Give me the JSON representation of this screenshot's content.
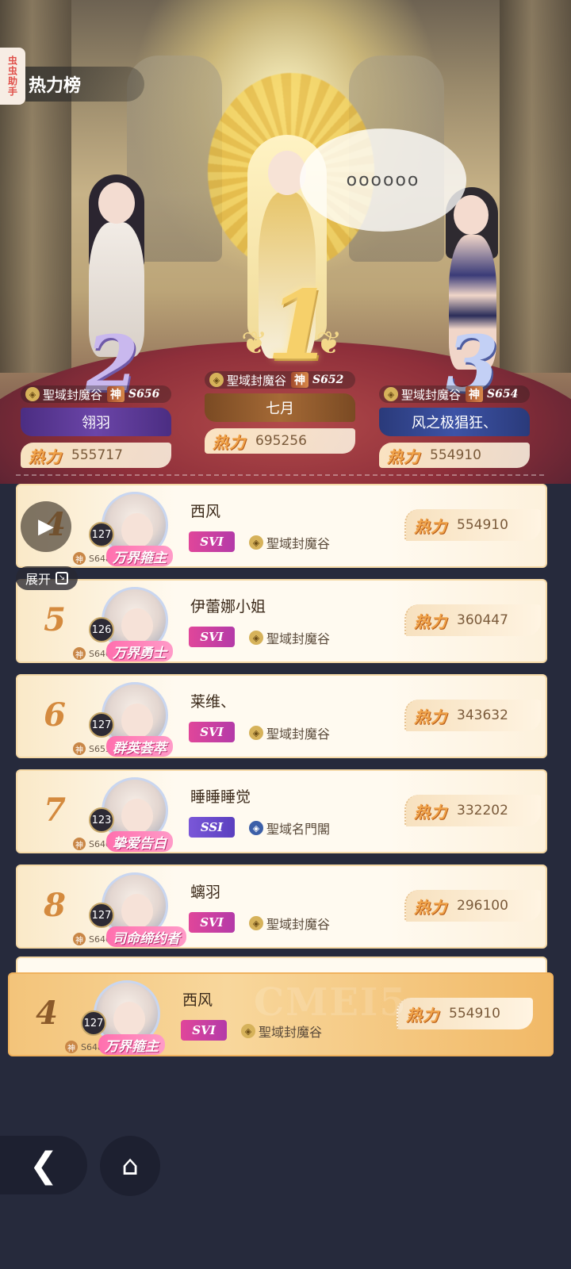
{
  "side_tab": {
    "label": "虫虫助手"
  },
  "header": {
    "title": "热力榜"
  },
  "speech_bubble": {
    "text": "oooooo"
  },
  "podium": [
    {
      "rank": "1",
      "guild": "聖域封魔谷",
      "shen": "神",
      "server": "S652",
      "name": "七月",
      "heat_label": "热力",
      "heat": "695256"
    },
    {
      "rank": "2",
      "guild": "聖域封魔谷",
      "shen": "神",
      "server": "S656",
      "name": "翎羽",
      "heat_label": "热力",
      "heat": "555717"
    },
    {
      "rank": "3",
      "guild": "聖域封魔谷",
      "shen": "神",
      "server": "S654",
      "name": "风之极猖狂、",
      "heat_label": "热力",
      "heat": "554910"
    }
  ],
  "list": [
    {
      "rank": "4",
      "level": "127",
      "shen": "神",
      "server": "S648",
      "title": "万界箍主",
      "name": "西风",
      "vip": "SVI",
      "guild": "聖域封魔谷",
      "heat_label": "热力",
      "heat": "554910"
    },
    {
      "rank": "5",
      "level": "126",
      "shen": "神",
      "server": "S646",
      "title": "万界勇士",
      "name": "伊蕾娜小姐",
      "vip": "SVI",
      "guild": "聖域封魔谷",
      "heat_label": "热力",
      "heat": "360447"
    },
    {
      "rank": "6",
      "level": "127",
      "shen": "神",
      "server": "S653",
      "title": "群英荟萃",
      "name": "莱维、",
      "vip": "SVI",
      "guild": "聖域封魔谷",
      "heat_label": "热力",
      "heat": "343632"
    },
    {
      "rank": "7",
      "level": "123",
      "shen": "神",
      "server": "S646",
      "title": "挚爱告白",
      "name": "睡睡睡觉",
      "vip": "SSI",
      "guild": "聖域名門閣",
      "heat_label": "热力",
      "heat": "332202"
    },
    {
      "rank": "8",
      "level": "127",
      "shen": "神",
      "server": "S646",
      "title": "司命缔约者",
      "name": "螭羽",
      "vip": "SVI",
      "guild": "聖域封魔谷",
      "heat_label": "热力",
      "heat": "296100"
    }
  ],
  "my_rank": {
    "rank": "4",
    "level": "127",
    "shen": "神",
    "server": "S648",
    "title": "万界箍主",
    "name": "西风",
    "vip": "SVI",
    "guild": "聖域封魔谷",
    "heat_label": "热力",
    "heat": "554910"
  },
  "controls": {
    "expand_label": "展开"
  },
  "watermark": "CMEI5",
  "icons": {
    "play": "play-icon",
    "expand": "expand-icon",
    "back": "back-arrow-icon",
    "home": "home-icon",
    "guild": "guild-emblem-icon"
  },
  "colors": {
    "accent": "#f0a34a",
    "list_bg": "#fffaf0",
    "page_bg": "#262a3c"
  }
}
